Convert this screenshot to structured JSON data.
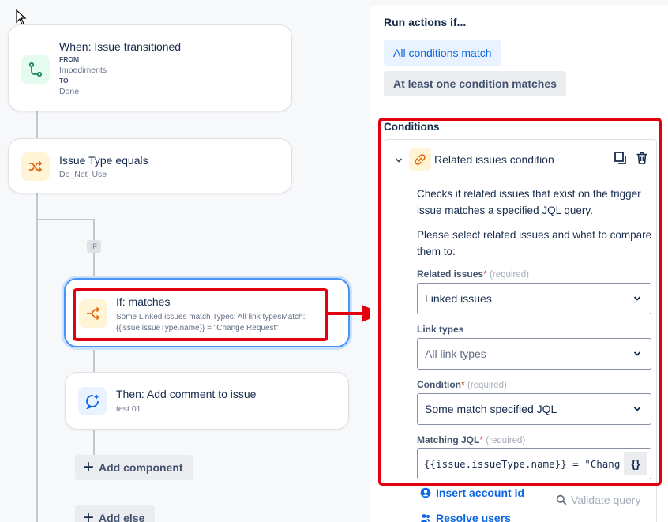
{
  "canvas": {
    "trigger": {
      "title": "When: Issue transitioned",
      "from_label": "FROM",
      "from_value": "Impediments",
      "to_label": "TO",
      "to_value": "Done"
    },
    "condition": {
      "title": "Issue Type equals",
      "value": "Do_Not_Use"
    },
    "if_pill": "IF",
    "if_card": {
      "title": "If: matches",
      "line1": "Some Linked issues match Types: All link typesMatch:",
      "line2": "{{issue.issueType.name}} = \"Change Request\""
    },
    "then_card": {
      "title": "Then: Add comment to issue",
      "value": "test 01"
    },
    "add_component": "Add component",
    "add_else": "Add else"
  },
  "panel": {
    "run_actions_label": "Run actions if...",
    "option_all": "All conditions match",
    "option_any": "At least one condition matches",
    "conditions_title": "Conditions",
    "condition_item": {
      "title": "Related issues condition",
      "desc1": "Checks if related issues that exist on the trigger issue matches a specified JQL query.",
      "desc2": "Please select related issues and what to compare them to:",
      "related_label": "Related issues",
      "required_mark": "*",
      "required_text": "(required)",
      "related_value": "Linked issues",
      "link_types_label": "Link types",
      "link_types_value": "All link types",
      "condition_label": "Condition",
      "condition_value": "Some match specified JQL",
      "jql_label": "Matching JQL",
      "jql_value": "{{issue.issueType.name}} = \"Change Request\"",
      "jql_brace": "{}",
      "insert_account": "Insert account id",
      "resolve_users": "Resolve users",
      "validate_query": "Validate query"
    }
  },
  "colors": {
    "accent": "#0c66e4",
    "highlight": "#e3000f",
    "trigger_icon_bg": "#e3fcef",
    "condition_icon_bg": "#fff4d6",
    "action_icon_bg": "#e9f2ff"
  }
}
